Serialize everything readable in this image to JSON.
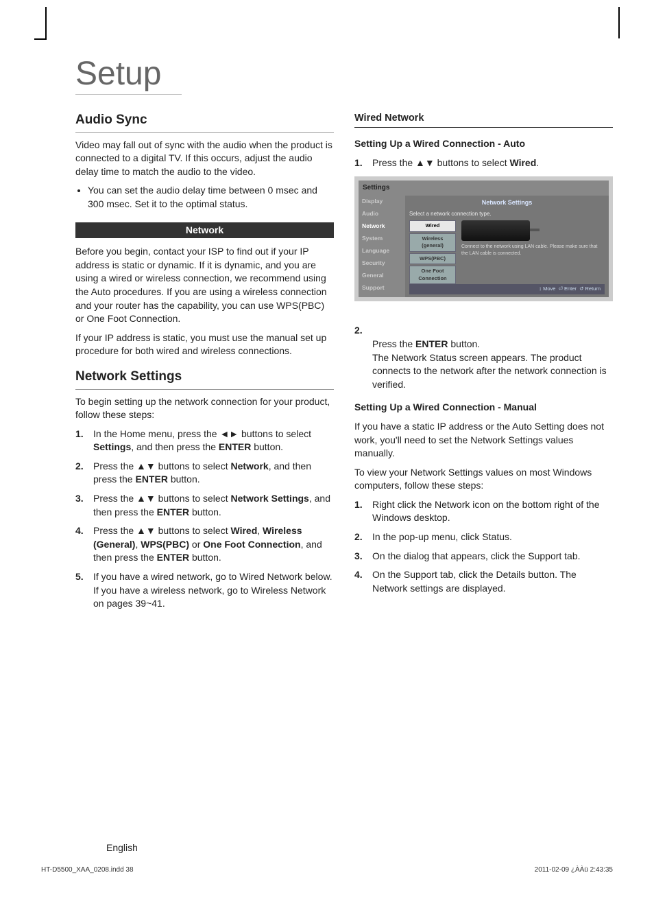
{
  "page_title": "Setup",
  "left": {
    "h_audio_sync": "Audio Sync",
    "p_audio_sync": "Video may fall out of sync with the audio when the product is connected to a digital TV. If this occurs, adjust the audio delay time to match the audio to the video.",
    "bullet_audio_delay": "You can set the audio delay time between 0 msec and 300 msec. Set it to the optimal status.",
    "bar_network": "Network",
    "p_network1": "Before you begin, contact your ISP to find out if your IP address is static or dynamic. If it is dynamic, and you are using a wired or wireless connection, we recommend using the Auto procedures. If you are using a wireless connection and your router has the capability, you can use WPS(PBC) or One Foot Connection.",
    "p_network2": "If your IP address is static, you must use the manual set up procedure for both wired and wireless connections.",
    "h_network_settings": "Network Settings",
    "p_ns_intro": "To begin setting up the network connection for your product, follow these steps:",
    "ns_steps": [
      {
        "n": "1.",
        "pre": "In the Home menu, press the ",
        "arr": "◄►",
        "mid": " buttons to select ",
        "b1": "Settings",
        "mid2": ", and then press the ",
        "b2": "ENTER",
        "end": " button."
      },
      {
        "n": "2.",
        "pre": "Press the ",
        "arr": "▲▼",
        "mid": " buttons to select ",
        "b1": "Network",
        "mid2": ", and then press the ",
        "b2": "ENTER",
        "end": " button."
      },
      {
        "n": "3.",
        "pre": "Press the ",
        "arr": "▲▼",
        "mid": " buttons to select ",
        "b1": "Network Settings",
        "mid2": ", and then press the ",
        "b2": "ENTER",
        "end": " button."
      },
      {
        "n": "4.",
        "pre": "Press the ",
        "arr": "▲▼",
        "mid": " buttons to select ",
        "b1": "Wired",
        "sep1": ", ",
        "b2": "Wireless (General)",
        "sep2": ", ",
        "b3": "WPS(PBC)",
        "sep3": " or ",
        "b4": "One Foot Connection",
        "mid2": ", and then press the ",
        "b5": "ENTER",
        "end": " button."
      },
      {
        "n": "5.",
        "text": "If you have a wired network, go to Wired Network below. If you have a wireless network, go to Wireless Network on pages 39~41."
      }
    ]
  },
  "right": {
    "h_wired": "Wired Network",
    "h_auto": "Setting Up a Wired Connection - Auto",
    "step1_n": "1.",
    "step1_pre": "Press the ",
    "step1_arr": "▲▼",
    "step1_mid": " buttons to select ",
    "step1_b": "Wired",
    "step1_end": ".",
    "settings": {
      "title": "Settings",
      "nav": [
        "Display",
        "Audio",
        "Network",
        "System",
        "Language",
        "Security",
        "General",
        "Support"
      ],
      "nav_selected": 2,
      "main_title": "Network Settings",
      "subtitle": "Select a network connection type.",
      "options": [
        "Wired",
        "Wireless (general)",
        "WPS(PBC)",
        "One Foot Connection"
      ],
      "opt_selected": 0,
      "desc": "Connect to the network using LAN cable. Please make sure that the LAN cable is connected.",
      "hints_move": "Move",
      "hints_enter": "Enter",
      "hints_return": "Return"
    },
    "step2_n": "2.",
    "step2_pre": "Press the ",
    "step2_b": "ENTER",
    "step2_end": " button.\nThe Network Status screen appears. The product connects to the network after the network connection is verified.",
    "h_manual": "Setting Up a Wired Connection - Manual",
    "p_manual1": "If you have a static IP address or the Auto Setting does not work, you'll need to set the Network Settings values manually.",
    "p_manual2": "To view your Network Settings values on most Windows computers, follow these steps:",
    "manual_steps": [
      {
        "n": "1.",
        "text": "Right click the Network icon on the bottom right of the Windows desktop."
      },
      {
        "n": "2.",
        "text": "In the pop-up menu, click Status."
      },
      {
        "n": "3.",
        "text": "On the dialog that appears, click the Support tab."
      },
      {
        "n": "4.",
        "text": "On the Support tab, click the Details button. The Network settings are displayed."
      }
    ]
  },
  "footer": {
    "lang": "English",
    "file": "HT-D5500_XAA_0208.indd   38",
    "date": "2011-02-09   ¿ÀÀü 2:43:35"
  }
}
